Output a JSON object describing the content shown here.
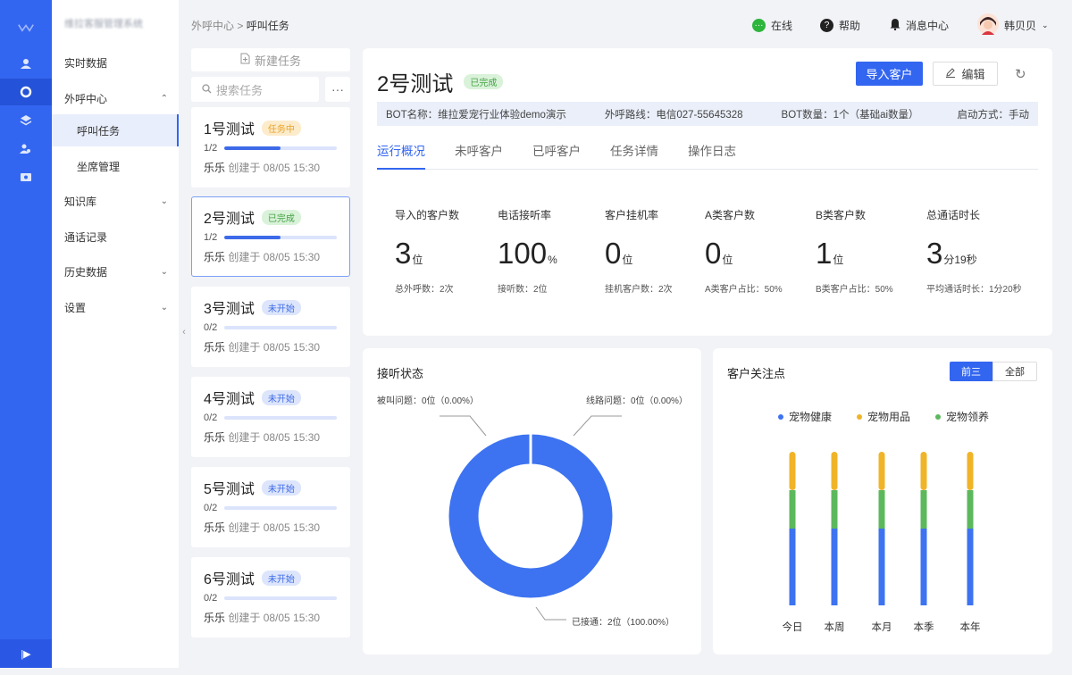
{
  "app": {
    "brand": "维拉客服管理系统"
  },
  "sidebar": {
    "items": [
      {
        "label": "实时数据",
        "type": "item"
      },
      {
        "label": "外呼中心",
        "type": "group-open"
      },
      {
        "label": "呼叫任务",
        "type": "sub-selected"
      },
      {
        "label": "坐席管理",
        "type": "sub"
      },
      {
        "label": "知识库",
        "type": "group"
      },
      {
        "label": "通话记录",
        "type": "item"
      },
      {
        "label": "历史数据",
        "type": "group"
      },
      {
        "label": "设置",
        "type": "group"
      }
    ]
  },
  "breadcrumb": {
    "parent": "外呼中心",
    "separator": ">",
    "current": "呼叫任务"
  },
  "topbar": {
    "online": "在线",
    "help": "帮助",
    "messages": "消息中心",
    "user": "韩贝贝"
  },
  "tasks": {
    "new_label": "新建任务",
    "search_placeholder": "搜索任务",
    "more": "···",
    "list": [
      {
        "title": "1号测试",
        "status": "任务中",
        "status_kind": "run",
        "progress": "1/2",
        "fill": 0.5,
        "owner": "乐乐",
        "created": "创建于 08/05 15:30"
      },
      {
        "title": "2号测试",
        "status": "已完成",
        "status_kind": "done",
        "progress": "1/2",
        "fill": 0.5,
        "owner": "乐乐",
        "created": "创建于 08/05 15:30"
      },
      {
        "title": "3号测试",
        "status": "未开始",
        "status_kind": "wait",
        "progress": "0/2",
        "fill": 0,
        "owner": "乐乐",
        "created": "创建于 08/05 15:30"
      },
      {
        "title": "4号测试",
        "status": "未开始",
        "status_kind": "wait",
        "progress": "0/2",
        "fill": 0,
        "owner": "乐乐",
        "created": "创建于 08/05 15:30"
      },
      {
        "title": "5号测试",
        "status": "未开始",
        "status_kind": "wait",
        "progress": "0/2",
        "fill": 0,
        "owner": "乐乐",
        "created": "创建于 08/05 15:30"
      },
      {
        "title": "6号测试",
        "status": "未开始",
        "status_kind": "wait",
        "progress": "0/2",
        "fill": 0,
        "owner": "乐乐",
        "created": "创建于 08/05 15:30"
      }
    ]
  },
  "detail": {
    "title": "2号测试",
    "status": "已完成",
    "import_label": "导入客户",
    "edit_label": "编辑",
    "info": {
      "bot": "BOT名称：维拉爱宠行业体验demo演示",
      "line": "外呼路线：电信027-55645328",
      "count": "BOT数量：1个（基础ai数量）",
      "start": "启动方式：手动"
    },
    "tabs": [
      "运行概况",
      "未呼客户",
      "已呼客户",
      "任务详情",
      "操作日志"
    ],
    "stats": [
      {
        "label": "导入的客户数",
        "value": "3",
        "unit": "位",
        "sub": "总外呼数：2次"
      },
      {
        "label": "电话接听率",
        "value": "100",
        "unit": "%",
        "sub": "接听数：2位"
      },
      {
        "label": "客户挂机率",
        "value": "0",
        "unit": "位",
        "sub": "挂机客户数：2次"
      },
      {
        "label": "A类客户数",
        "value": "0",
        "unit": "位",
        "sub": "A类客户占比：50%"
      },
      {
        "label": "B类客户数",
        "value": "1",
        "unit": "位",
        "sub": "B类客户占比：50%"
      },
      {
        "label": "总通话时长",
        "value": "3",
        "unit": "分19秒",
        "sub": "平均通话时长：1分20秒"
      }
    ]
  },
  "answer_card": {
    "title": "接听状态"
  },
  "focus_card": {
    "title": "客户关注点",
    "toggle": [
      "前三",
      "全部"
    ]
  },
  "chart_data": [
    {
      "type": "pie",
      "title": "接听状态",
      "donut": true,
      "slices": [
        {
          "label": "被叫问题：0位（0.00%）",
          "value": 0
        },
        {
          "label": "线路问题：0位（0.00%）",
          "value": 0
        },
        {
          "label": "已接通：2位（100.00%）",
          "value": 2
        }
      ],
      "color": "#3d73f0"
    },
    {
      "type": "bar",
      "title": "客户关注点",
      "stacked": true,
      "categories": [
        "今日",
        "本周",
        "本月",
        "本季",
        "本年"
      ],
      "series": [
        {
          "name": "宠物健康",
          "color": "#3d73f0",
          "values": [
            5,
            5,
            5,
            5,
            5
          ]
        },
        {
          "name": "宠物领养",
          "color": "#5cb85c",
          "values": [
            2.5,
            2.5,
            2.5,
            2.5,
            2.5
          ]
        },
        {
          "name": "宠物用品",
          "color": "#f0b429",
          "values": [
            2.5,
            2.5,
            2.5,
            2.5,
            2.5
          ]
        }
      ],
      "legend_order": [
        "宠物健康",
        "宠物用品",
        "宠物领养"
      ]
    }
  ],
  "icons": [
    "rail-user-icon",
    "rail-headset-icon",
    "rail-layers-icon",
    "rail-contacts-icon",
    "rail-monitor-icon",
    "wechat-icon",
    "help-icon",
    "bell-icon",
    "avatar",
    "file-plus-icon",
    "search-icon",
    "pencil-icon",
    "refresh-icon",
    "chevron-down-icon"
  ]
}
